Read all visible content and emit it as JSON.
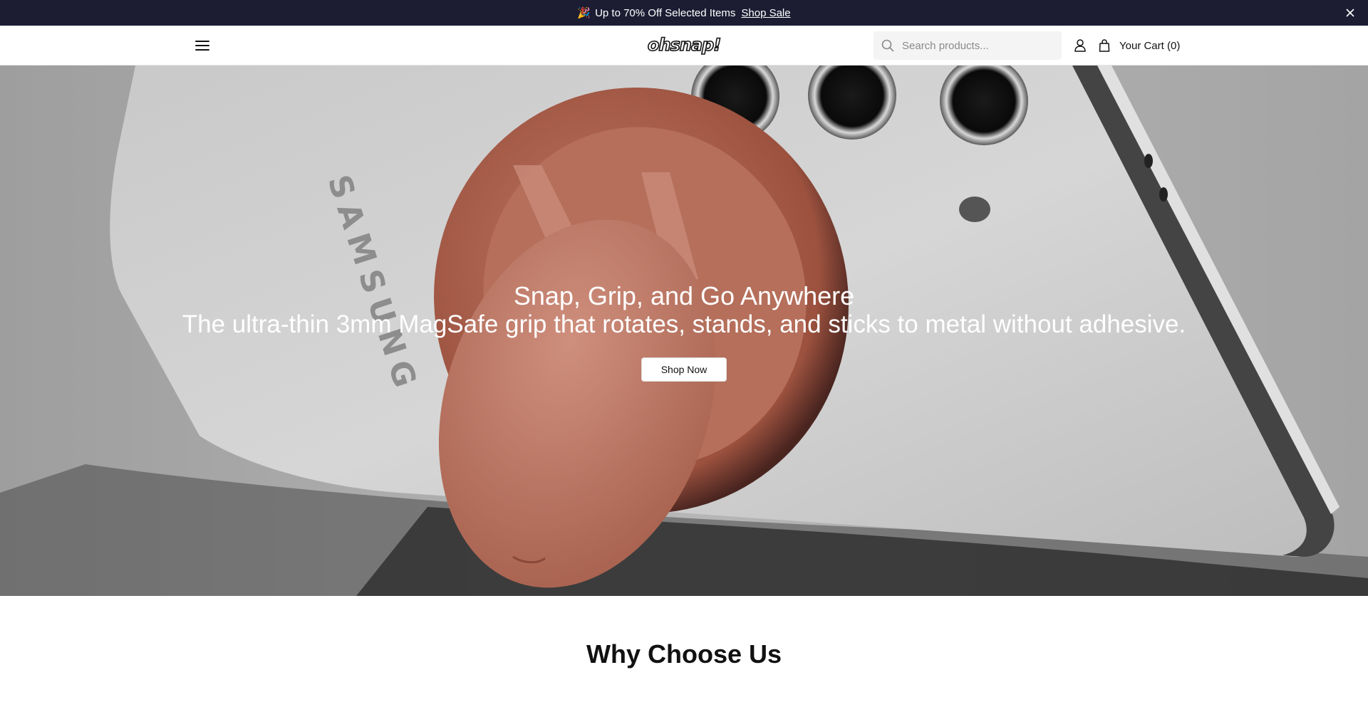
{
  "announcement": {
    "emoji": "🎉",
    "text": "Up to 70% Off Selected Items",
    "link_label": "Shop Sale",
    "close_icon": "close-icon"
  },
  "header": {
    "menu_icon": "hamburger-menu-icon",
    "logo": "ohsnap!",
    "search": {
      "placeholder": "Search products...",
      "value": ""
    },
    "account_icon": "user-icon",
    "cart_label": "Your Cart (0)"
  },
  "hero": {
    "title": "Snap, Grip, and Go Anywhere",
    "subtitle": "The ultra-thin 3mm MagSafe grip that rotates, stands, and sticks to metal without adhesive.",
    "cta_label": "Shop Now",
    "brand_text": "SAMSUNG"
  },
  "section": {
    "title": "Why Choose Us"
  },
  "colors": {
    "announcement_bg": "#1c1d33",
    "grip_accent": "#c9806b"
  }
}
